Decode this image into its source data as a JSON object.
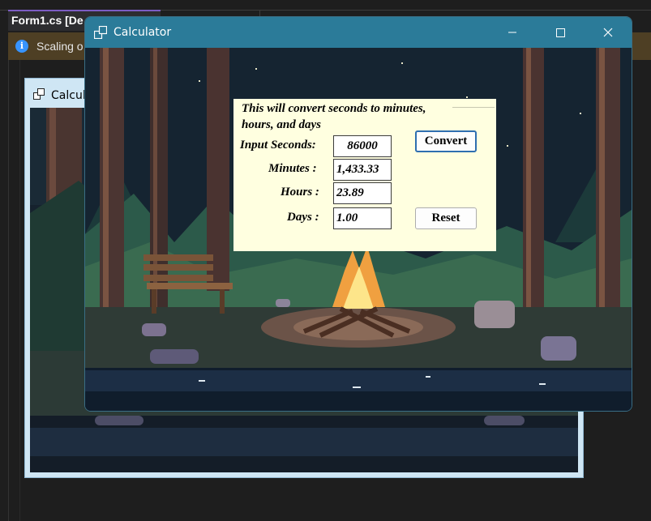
{
  "ide": {
    "tab_label": "Form1.cs [De",
    "info_text": "Scaling o"
  },
  "designer": {
    "title": "Calcul"
  },
  "window": {
    "title": "Calculator"
  },
  "calculator": {
    "description": "This will convert seconds to minutes, hours, and days",
    "input_label": "Input Seconds:",
    "input_value": "86000",
    "minutes_label": "Minutes :",
    "minutes_value": "1,433.33",
    "hours_label": "Hours :",
    "hours_value": "23.89",
    "days_label": "Days :",
    "days_value": "1.00",
    "convert_label": "Convert",
    "reset_label": "Reset"
  },
  "colors": {
    "titlebar": "#2b7b99",
    "panel_bg": "#ffffe0",
    "info_bar": "#4e3f24",
    "accent": "#7c5cc4"
  },
  "icons": [
    "window-app-icon",
    "info-icon",
    "minimize-icon",
    "maximize-icon",
    "close-icon"
  ]
}
